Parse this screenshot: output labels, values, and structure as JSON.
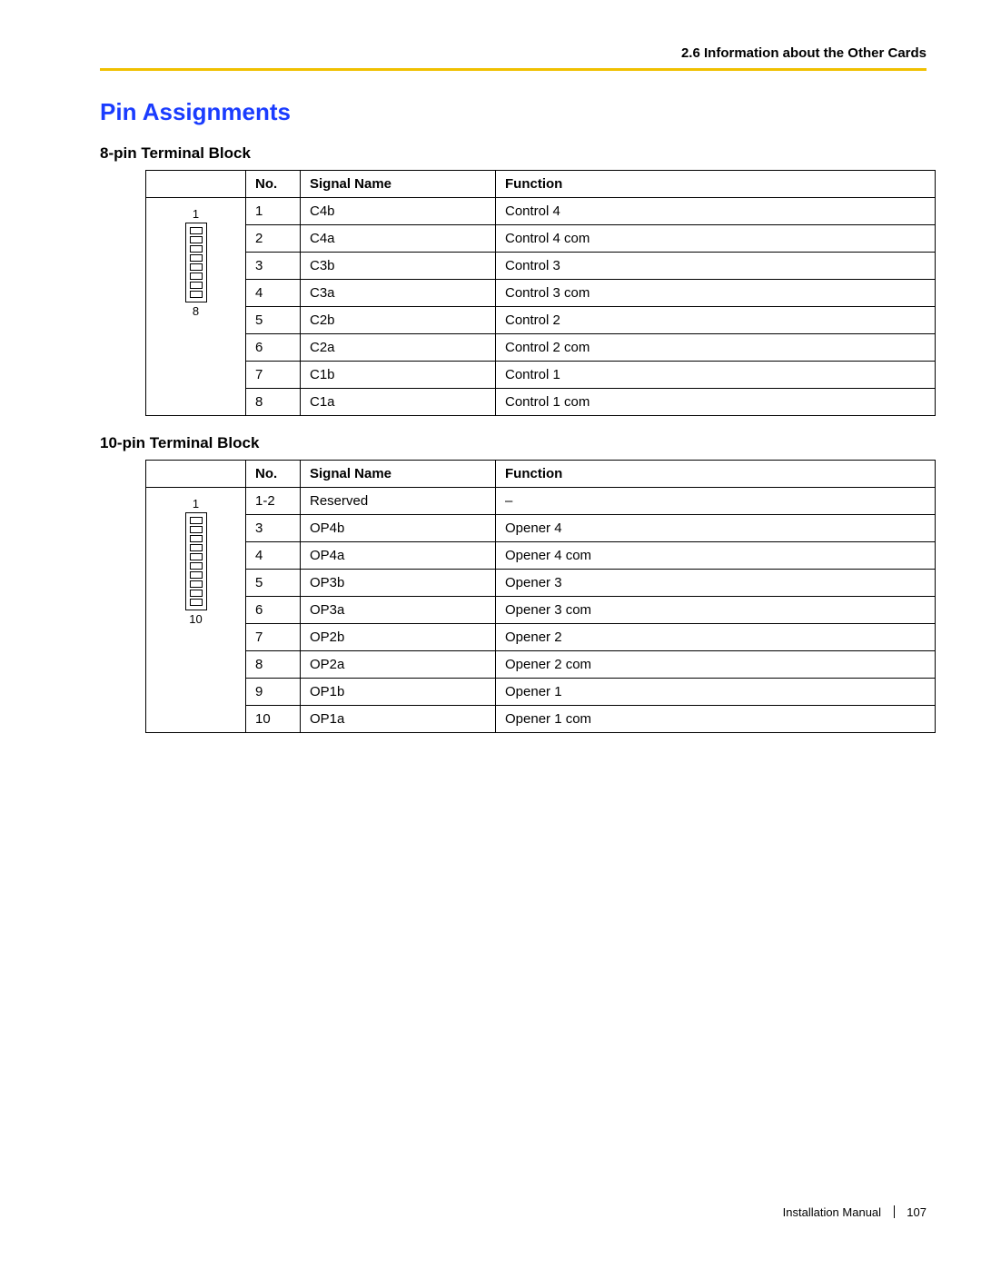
{
  "header": {
    "section": "2.6 Information about the Other Cards"
  },
  "title": "Pin Assignments",
  "block8": {
    "heading": "8-pin Terminal Block",
    "head": {
      "no": "No.",
      "signal": "Signal Name",
      "func": "Function"
    },
    "diag": {
      "top": "1",
      "bot": "8",
      "pins": 8
    },
    "rows": [
      {
        "no": "1",
        "signal": "C4b",
        "func": "Control 4"
      },
      {
        "no": "2",
        "signal": "C4a",
        "func": "Control 4 com"
      },
      {
        "no": "3",
        "signal": "C3b",
        "func": "Control 3"
      },
      {
        "no": "4",
        "signal": "C3a",
        "func": "Control 3 com"
      },
      {
        "no": "5",
        "signal": "C2b",
        "func": "Control 2"
      },
      {
        "no": "6",
        "signal": "C2a",
        "func": "Control 2 com"
      },
      {
        "no": "7",
        "signal": "C1b",
        "func": "Control 1"
      },
      {
        "no": "8",
        "signal": "C1a",
        "func": "Control 1 com"
      }
    ]
  },
  "block10": {
    "heading": "10-pin Terminal Block",
    "head": {
      "no": "No.",
      "signal": "Signal Name",
      "func": "Function"
    },
    "diag": {
      "top": "1",
      "bot": "10",
      "pins": 10
    },
    "rows": [
      {
        "no": "1-2",
        "signal": "Reserved",
        "func": "–"
      },
      {
        "no": "3",
        "signal": "OP4b",
        "func": "Opener 4"
      },
      {
        "no": "4",
        "signal": "OP4a",
        "func": "Opener 4 com"
      },
      {
        "no": "5",
        "signal": "OP3b",
        "func": "Opener 3"
      },
      {
        "no": "6",
        "signal": "OP3a",
        "func": "Opener 3 com"
      },
      {
        "no": "7",
        "signal": "OP2b",
        "func": "Opener 2"
      },
      {
        "no": "8",
        "signal": "OP2a",
        "func": "Opener 2 com"
      },
      {
        "no": "9",
        "signal": "OP1b",
        "func": "Opener 1"
      },
      {
        "no": "10",
        "signal": "OP1a",
        "func": "Opener 1 com"
      }
    ]
  },
  "footer": {
    "manual": "Installation Manual",
    "page": "107"
  }
}
